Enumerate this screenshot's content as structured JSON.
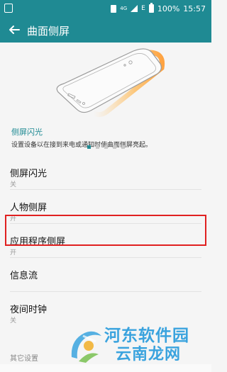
{
  "status_bar": {
    "network": "4G",
    "data_indicator": "E",
    "battery": "100%",
    "time": "15:57"
  },
  "app_bar": {
    "title": "曲面侧屏"
  },
  "intro": {
    "title": "侧屏闪光",
    "description": "设置设备以在接到来电或通知时使曲面侧屏亮起。",
    "page_indicator": {
      "total": 5,
      "current": 1
    }
  },
  "settings": [
    {
      "label": "侧屏闪光",
      "status": "关"
    },
    {
      "label": "人物侧屏",
      "status": "开"
    },
    {
      "label": "应用程序侧屏",
      "status": "开"
    },
    {
      "label": "信息流",
      "status": ""
    },
    {
      "label": "夜间时钟",
      "status": "关"
    }
  ],
  "section_header": "其它设置",
  "watermark": {
    "line1": "河东软件园",
    "line2": "云南龙网"
  },
  "colors": {
    "accent": "#1f8a93",
    "highlight_border": "#e02020",
    "edge_glow": "#ffb347",
    "watermark": "#3aa3de"
  }
}
